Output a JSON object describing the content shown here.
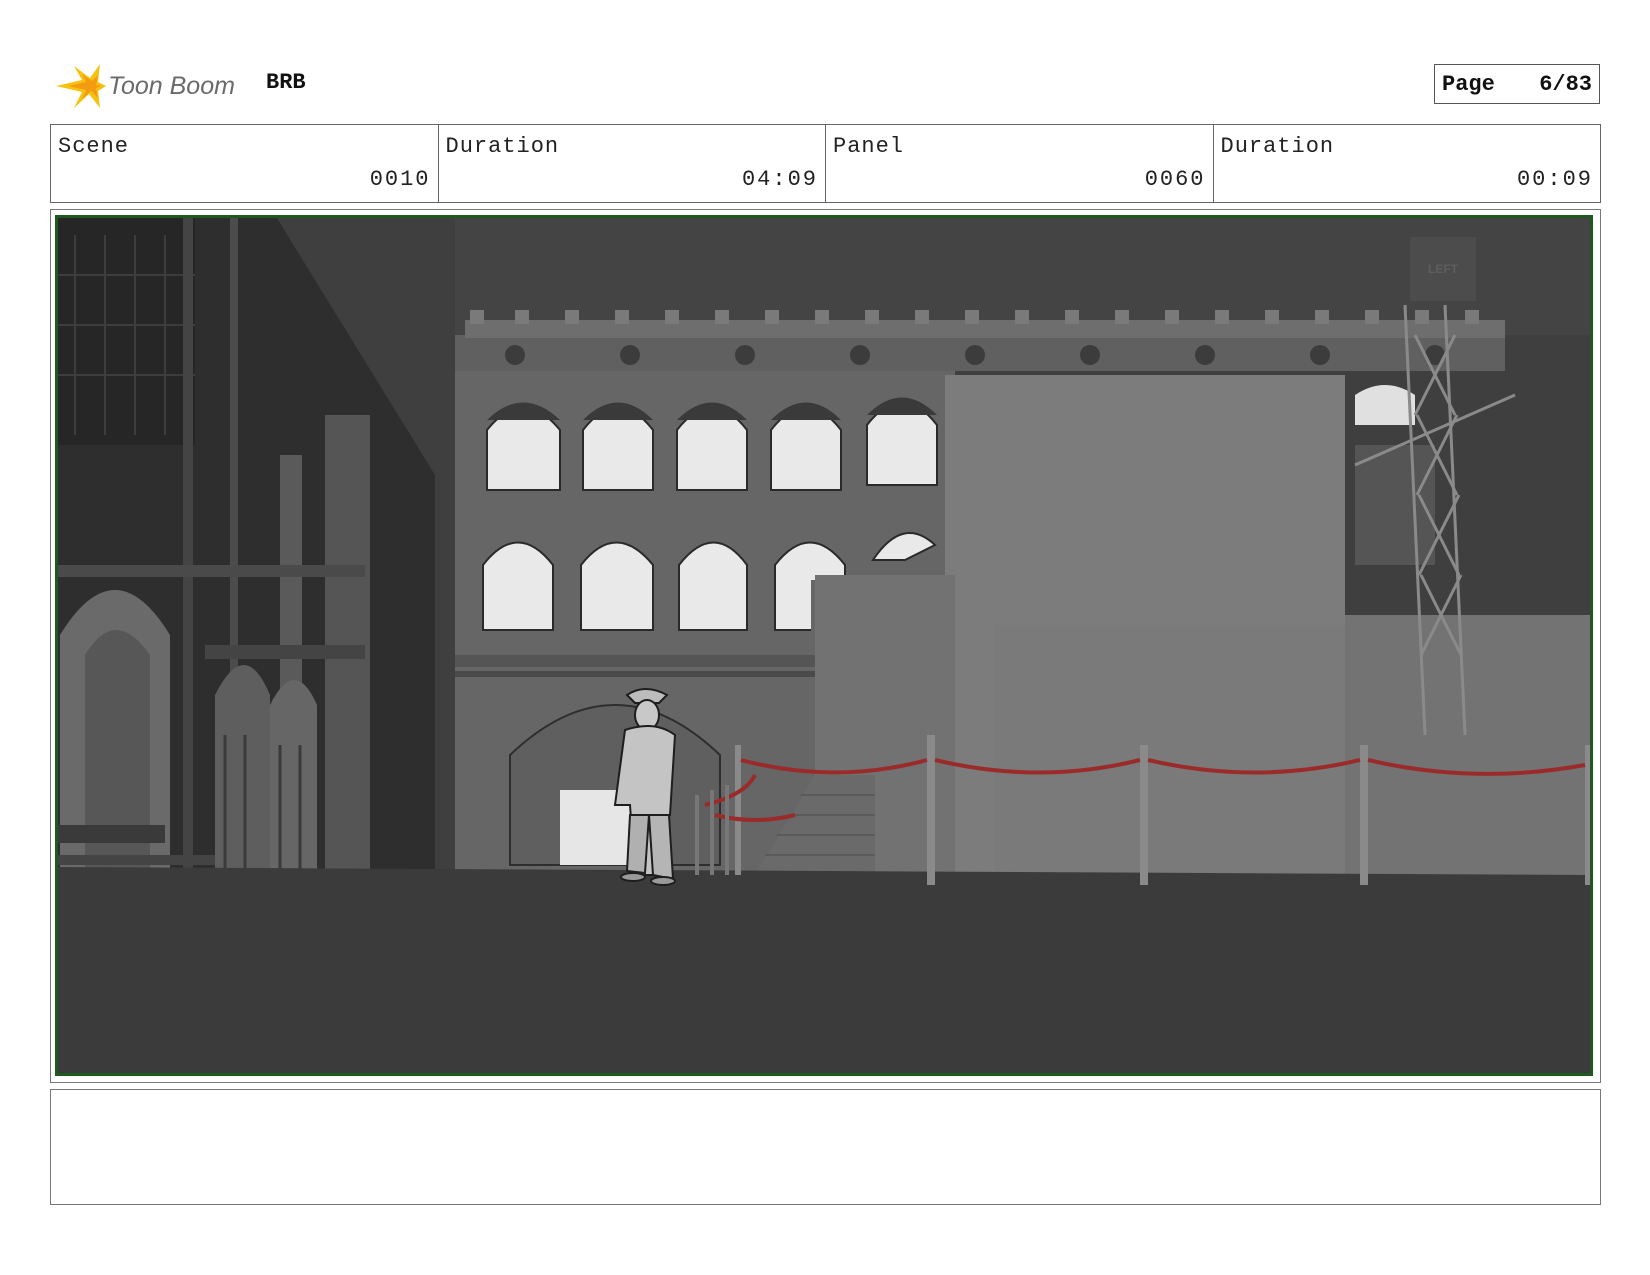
{
  "header": {
    "logo_text": "Toon Boom",
    "project": "BRB",
    "page_label": "Page",
    "page_value": "6/83"
  },
  "info": [
    {
      "label": "Scene",
      "value": "0010"
    },
    {
      "label": "Duration",
      "value": "04:09"
    },
    {
      "label": "Panel",
      "value": "0060"
    },
    {
      "label": "Duration",
      "value": "00:09"
    }
  ],
  "panel": {
    "sign_text": "LEFT",
    "rope_color": "#9b2b2b",
    "frame_border_color": "#1e5a1e"
  },
  "notes": ""
}
